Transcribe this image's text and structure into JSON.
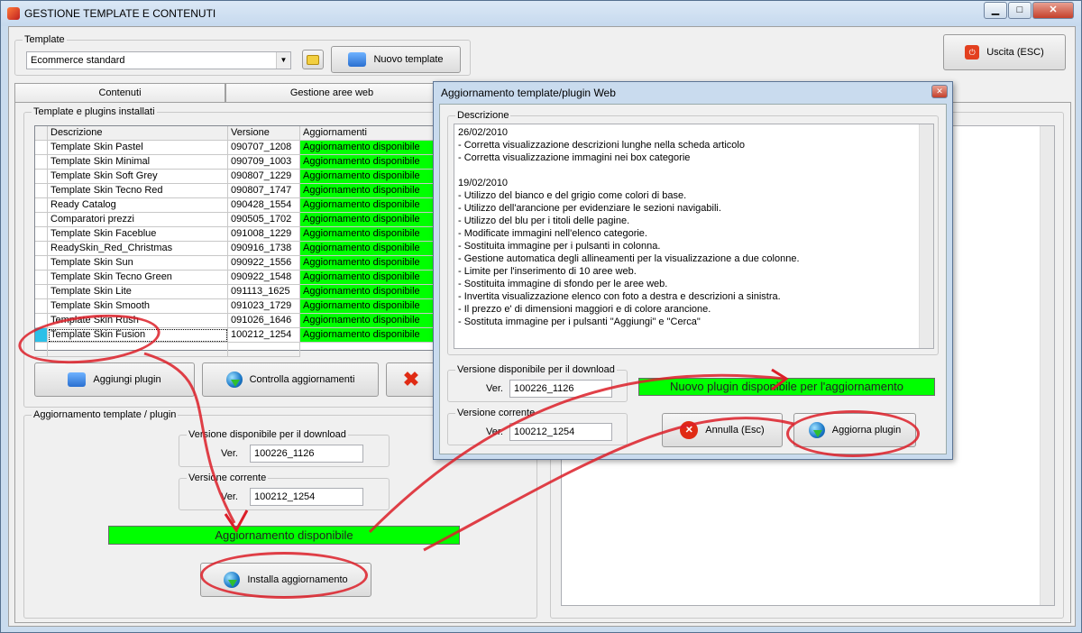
{
  "window": {
    "title": "GESTIONE TEMPLATE E CONTENUTI",
    "min": "▁",
    "max": "□",
    "close": "✕"
  },
  "template": {
    "legend": "Template",
    "selected": "Ecommerce standard",
    "new_button": "Nuovo template"
  },
  "exit_button": "Uscita (ESC)",
  "tabs": [
    "Contenuti",
    "Gestione aree web"
  ],
  "installed": {
    "legend": "Template e plugins installati",
    "headers": [
      "Descrizione",
      "Versione",
      "Aggiornamenti"
    ],
    "rows": [
      [
        "Template Skin Pastel",
        "090707_1208",
        "Aggiornamento disponibile"
      ],
      [
        "Template Skin Minimal",
        "090709_1003",
        "Aggiornamento disponibile"
      ],
      [
        "Template Skin Soft Grey",
        "090807_1229",
        "Aggiornamento disponibile"
      ],
      [
        "Template Skin Tecno Red",
        "090807_1747",
        "Aggiornamento disponibile"
      ],
      [
        "Ready Catalog",
        "090428_1554",
        "Aggiornamento disponibile"
      ],
      [
        "Comparatori prezzi",
        "090505_1702",
        "Aggiornamento disponibile"
      ],
      [
        "Template Skin Faceblue",
        "091008_1229",
        "Aggiornamento disponibile"
      ],
      [
        "ReadySkin_Red_Christmas",
        "090916_1738",
        "Aggiornamento disponibile"
      ],
      [
        "Template Skin Sun",
        "090922_1556",
        "Aggiornamento disponibile"
      ],
      [
        "Template Skin Tecno Green",
        "090922_1548",
        "Aggiornamento disponibile"
      ],
      [
        "Template Skin Lite",
        "091113_1625",
        "Aggiornamento disponibile"
      ],
      [
        "Template Skin Smooth",
        "091023_1729",
        "Aggiornamento disponibile"
      ],
      [
        "Template Skin Rush",
        "091026_1646",
        "Aggiornamento disponibile"
      ],
      [
        "Template Skin Fusion",
        "100212_1254",
        "Aggiornamento disponibile"
      ]
    ]
  },
  "buttons": {
    "add_plugin": "Aggiungi plugin",
    "check_updates": "Controlla aggiornamenti"
  },
  "update_group": {
    "legend": "Aggiornamento template / plugin",
    "download_legend": "Versione disponibile per il download",
    "ver_label": "Ver.",
    "download_ver": "100226_1126",
    "current_legend": "Versione corrente",
    "current_ver": "100212_1254",
    "status": "Aggiornamento disponibile",
    "install_button": "Installa aggiornamento"
  },
  "dialog": {
    "title": "Aggiornamento template/plugin Web",
    "close": "✕",
    "desc_legend": "Descrizione",
    "description_lines": [
      "26/02/2010",
      "- Corretta visualizzazione descrizioni lunghe nella scheda articolo",
      "- Corretta visualizzazione immagini nei box categorie",
      "",
      "19/02/2010",
      "- Utilizzo del bianco e del grigio come colori di base.",
      "- Utilizzo dell'arancione per evidenziare le sezioni navigabili.",
      "- Utilizzo del blu per i titoli delle pagine.",
      "- Modificate immagini nell'elenco categorie.",
      "- Sostituita immagine per i pulsanti in colonna.",
      "- Gestione automatica degli allineamenti per la visualizzazione a due colonne.",
      "- Limite per l'inserimento di 10 aree web.",
      "- Sostituita immagine di sfondo per le aree web.",
      "- Invertita visualizzazione elenco con foto a destra e descrizioni a sinistra.",
      "- Il prezzo e' di dimensioni maggiori e di colore arancione.",
      "- Sostituta immagine per i pulsanti \"Aggiungi\" e \"Cerca\""
    ],
    "download_legend": "Versione disponibile per il download",
    "ver_label": "Ver.",
    "download_ver": "100226_1126",
    "current_legend": "Versione corrente",
    "current_ver": "100212_1254",
    "status": "Nuovo plugin disponibile per l'aggiornamento",
    "cancel_button": "Annulla (Esc)",
    "update_button": "Aggiorna plugin"
  },
  "colors": {
    "status_green": "#00ff00",
    "annotation_red": "#dc1e28"
  }
}
